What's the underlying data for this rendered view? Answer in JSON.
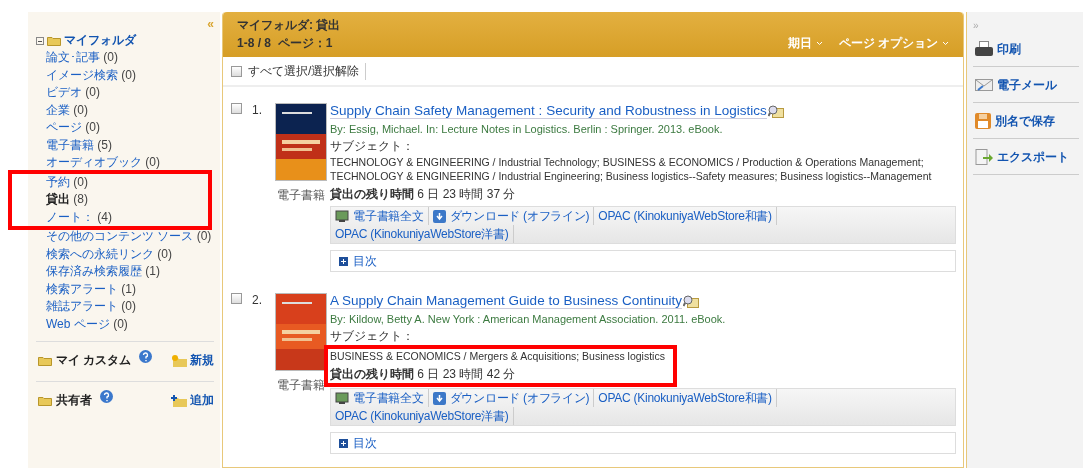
{
  "sidebar": {
    "collapse": "«",
    "folder_title": "マイフォルダ",
    "items": [
      {
        "label": "論文･記事",
        "count": "(0)",
        "selected": false,
        "highlighted": false
      },
      {
        "label": "イメージ検索",
        "count": "(0)",
        "selected": false,
        "highlighted": false
      },
      {
        "label": "ビデオ",
        "count": "(0)",
        "selected": false,
        "highlighted": false
      },
      {
        "label": "企業",
        "count": "(0)",
        "selected": false,
        "highlighted": false
      },
      {
        "label": "ページ",
        "count": "(0)",
        "selected": false,
        "highlighted": false
      },
      {
        "label": "電子書籍",
        "count": "(5)",
        "selected": false,
        "highlighted": false
      },
      {
        "label": "オーディオブック",
        "count": "(0)",
        "selected": false,
        "highlighted": false
      },
      {
        "label": "予約",
        "count": "(0)",
        "selected": false,
        "highlighted": true
      },
      {
        "label": "貸出",
        "count": "(8)",
        "selected": true,
        "highlighted": true
      },
      {
        "label": "ノート：",
        "count": "(4)",
        "selected": false,
        "highlighted": true
      },
      {
        "label": "その他のコンテンツ ソース",
        "count": "(0)",
        "selected": false,
        "highlighted": false
      },
      {
        "label": "検索への永続リンク",
        "count": "(0)",
        "selected": false,
        "highlighted": false
      },
      {
        "label": "保存済み検索履歴",
        "count": "(1)",
        "selected": false,
        "highlighted": false
      },
      {
        "label": "検索アラート",
        "count": "(1)",
        "selected": false,
        "highlighted": false
      },
      {
        "label": "雑誌アラート",
        "count": "(0)",
        "selected": false,
        "highlighted": false
      },
      {
        "label": "Web ページ",
        "count": "(0)",
        "selected": false,
        "highlighted": false
      }
    ],
    "sections": [
      {
        "title": "マイ カスタム",
        "action": "新規",
        "kind": "new"
      },
      {
        "title": "共有者",
        "action": "追加",
        "kind": "add"
      }
    ]
  },
  "header": {
    "title": "マイフォルダ: 貸出",
    "range": "1-8 / 8  ページ：1",
    "sort": "期日",
    "options": "ページ オプション"
  },
  "select_all": {
    "label": "すべて選択/選択解除",
    "checked": false
  },
  "results": [
    {
      "number": "1.",
      "checked": false,
      "highlighted": false,
      "format": "電子書籍",
      "title": "Supply Chain Safety Management : Security and Robustness in Logistics",
      "byline": "By: Essig, Michael. In: Lecture Notes in Logistics. Berlin : Springer. 2013. eBook.",
      "subject_label": "サブジェクト：",
      "subjects": [
        "TECHNOLOGY & ENGINEERING / Industrial Technology; BUSINESS & ECONOMICS / Production & Operations Management;",
        "TECHNOLOGY & ENGINEERING / Industrial Engineering; Business logistics--Safety measures; Business logistics--Management"
      ],
      "loan_label": "貸出の残り時間",
      "loan_time": "6 日 23 時間 37 分",
      "links": [
        {
          "label": "電子書籍全文",
          "kind": "fulltext"
        },
        {
          "label": "ダウンロード (オフライン)",
          "kind": "download"
        },
        {
          "label": "OPAC (KinokuniyaWebStore和書)",
          "kind": "plain"
        },
        {
          "label": "OPAC (KinokuniyaWebStore洋書)",
          "kind": "plain"
        }
      ],
      "toc": "目次"
    },
    {
      "number": "2.",
      "checked": false,
      "highlighted": true,
      "format": "電子書籍",
      "title": "A Supply Chain Management Guide to Business Continuity",
      "byline": "By: Kildow, Betty A. New York : American Management Association. 2011. eBook.",
      "subject_label": "サブジェクト：",
      "subjects": [
        "BUSINESS & ECONOMICS / Mergers & Acquisitions; Business logistics"
      ],
      "loan_label": "貸出の残り時間",
      "loan_time": "6 日 23 時間 42 分",
      "links": [
        {
          "label": "電子書籍全文",
          "kind": "fulltext"
        },
        {
          "label": "ダウンロード (オフライン)",
          "kind": "download"
        },
        {
          "label": "OPAC (KinokuniyaWebStore和書)",
          "kind": "plain"
        },
        {
          "label": "OPAC (KinokuniyaWebStore洋書)",
          "kind": "plain"
        }
      ],
      "toc": "目次"
    }
  ],
  "tools": {
    "expand": "»",
    "items": [
      {
        "label": "印刷",
        "kind": "print"
      },
      {
        "label": "電子メール",
        "kind": "email"
      },
      {
        "label": "別名で保存",
        "kind": "save"
      },
      {
        "label": "エクスポート",
        "kind": "export"
      }
    ]
  }
}
